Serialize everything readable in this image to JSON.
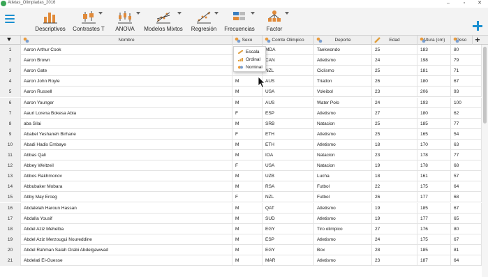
{
  "window": {
    "title": "Atletas_Olimpiadas_2016",
    "minimize": "–",
    "maximize": "▫",
    "close": "✕"
  },
  "ribbon": {
    "buttons": [
      {
        "label": "Descriptivos",
        "icon": "bar-chart-icon"
      },
      {
        "label": "Contrastes T",
        "icon": "t-test-icon"
      },
      {
        "label": "ANOVA",
        "icon": "anova-icon"
      },
      {
        "label": "Modelos Mixtos",
        "icon": "mixed-models-icon"
      },
      {
        "label": "Regresión",
        "icon": "regression-icon"
      },
      {
        "label": "Frecuencias",
        "icon": "frequencies-icon"
      },
      {
        "label": "Factor",
        "icon": "factor-icon"
      }
    ],
    "add_icon": "plus-icon"
  },
  "table": {
    "columns": [
      "Nombre",
      "Sexo",
      "Comte Olimpico",
      "Deporte",
      "Edad",
      "Altura (cm)",
      "Peso"
    ],
    "rows": [
      [
        "1",
        "Aaron Arthur Cook",
        "M",
        "MDA",
        "Taekwondo",
        "25",
        "183",
        "80"
      ],
      [
        "2",
        "Aaron Brown",
        "M",
        "CAN",
        "Atletismo",
        "24",
        "198",
        "79"
      ],
      [
        "3",
        "Aaron Gate",
        "M",
        "NZL",
        "Ciclismo",
        "25",
        "181",
        "71"
      ],
      [
        "4",
        "Aaron John Royle",
        "M",
        "AUS",
        "Triatlon",
        "26",
        "180",
        "67"
      ],
      [
        "5",
        "Aaron Russell",
        "M",
        "USA",
        "Voleibol",
        "23",
        "206",
        "93"
      ],
      [
        "6",
        "Aaron Younger",
        "M",
        "AUS",
        "Water Polo",
        "24",
        "193",
        "100"
      ],
      [
        "7",
        "Aauri Lorena Bokesa Abia",
        "F",
        "ESP",
        "Atletismo",
        "27",
        "180",
        "62"
      ],
      [
        "8",
        "aba Silai",
        "M",
        "SRB",
        "Natacion",
        "25",
        "185",
        "77"
      ],
      [
        "9",
        "Ababel Yeshaneh Birhane",
        "F",
        "ETH",
        "Atletismo",
        "25",
        "165",
        "54"
      ],
      [
        "10",
        "Abadi Hadis Embaye",
        "M",
        "ETH",
        "Atletismo",
        "18",
        "170",
        "63"
      ],
      [
        "11",
        "Abbas Qali",
        "M",
        "IOA",
        "Natacion",
        "23",
        "178",
        "77"
      ],
      [
        "12",
        "Abbey Weitzeil",
        "F",
        "USA",
        "Natacion",
        "19",
        "178",
        "68"
      ],
      [
        "13",
        "Abbos Rakhmonov",
        "M",
        "UZB",
        "Lucha",
        "18",
        "161",
        "57"
      ],
      [
        "14",
        "Abbubaker Mobara",
        "M",
        "RSA",
        "Futbol",
        "22",
        "175",
        "64"
      ],
      [
        "15",
        "Abby May Erceg",
        "F",
        "NZL",
        "Futbol",
        "26",
        "177",
        "68"
      ],
      [
        "16",
        "Abdalelah Haroun Hassan",
        "M",
        "QAT",
        "Atletismo",
        "19",
        "185",
        "67"
      ],
      [
        "17",
        "Abdalla Yousif",
        "M",
        "SUD",
        "Atletismo",
        "19",
        "177",
        "65"
      ],
      [
        "18",
        "Abdel Aziz Mehelba",
        "M",
        "EGY",
        "Tiro olimpico",
        "27",
        "176",
        "80"
      ],
      [
        "19",
        "Abdel Aziz Merzougui Noureddine",
        "M",
        "ESP",
        "Atletismo",
        "24",
        "175",
        "67"
      ],
      [
        "20",
        "Abdel Rahman Salah Orabi Abdelgawwad",
        "M",
        "EGY",
        "Box",
        "28",
        "185",
        "81"
      ],
      [
        "21",
        "Abdelati El-Guesse",
        "M",
        "MAR",
        "Atletismo",
        "23",
        "187",
        "64"
      ]
    ]
  },
  "measure_popup": {
    "items": [
      "Escala",
      "Ordinal",
      "Nominal"
    ]
  },
  "colors": {
    "accent": "#1a8fd0",
    "nominal": "#e89a3c",
    "scale": "#e0a040"
  }
}
